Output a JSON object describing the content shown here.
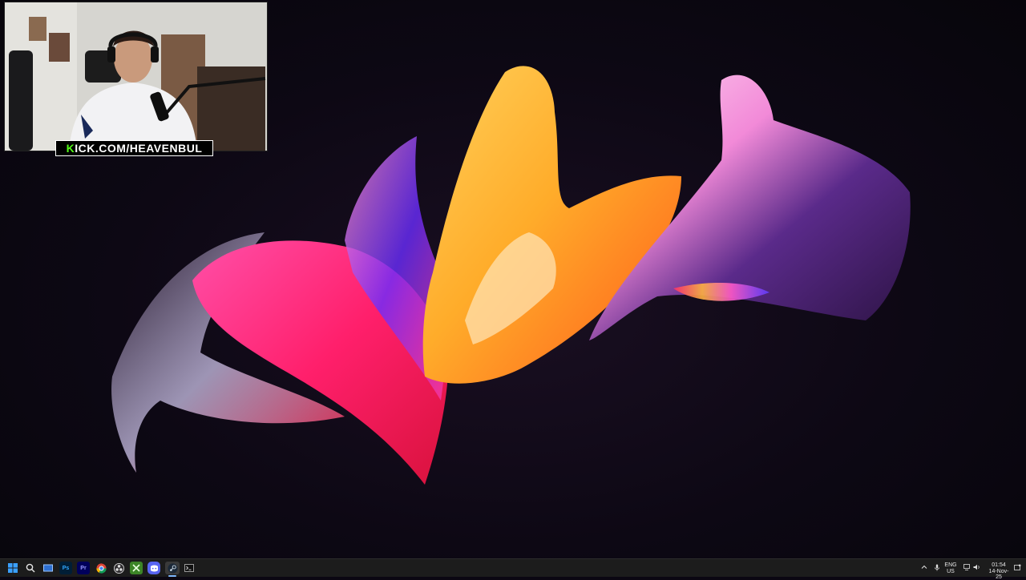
{
  "webcam": {
    "channel_prefix": "K",
    "channel_rest": "ICK.COM/HEAVENBUL"
  },
  "taskbar": {
    "apps": [
      {
        "name": "start-icon",
        "label": ""
      },
      {
        "name": "search-icon",
        "label": ""
      },
      {
        "name": "task-view-icon",
        "label": ""
      },
      {
        "name": "photoshop-icon",
        "label": "Ps"
      },
      {
        "name": "premiere-icon",
        "label": "Pr"
      },
      {
        "name": "chrome-icon",
        "label": ""
      },
      {
        "name": "obs-icon",
        "label": ""
      },
      {
        "name": "xbox-icon",
        "label": ""
      },
      {
        "name": "discord-icon",
        "label": ""
      },
      {
        "name": "steam-icon",
        "label": ""
      },
      {
        "name": "terminal-icon",
        "label": ""
      }
    ],
    "tray": {
      "language_top": "ENG",
      "language_bottom": "US",
      "time": "01:54",
      "date": "14-Nov-25"
    }
  },
  "colors": {
    "taskbar_bg": "#1c1c1c",
    "kick_green": "#53fc18",
    "desktop_bg": "#0b0712"
  }
}
